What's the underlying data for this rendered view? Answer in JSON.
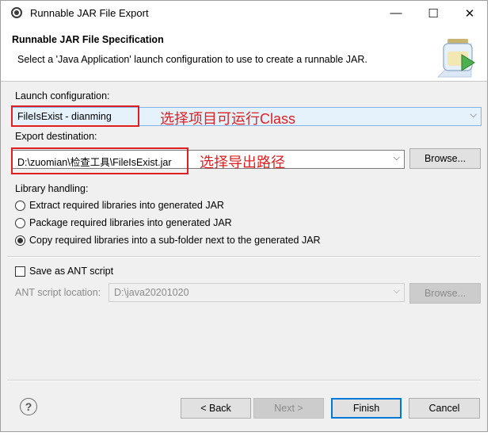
{
  "window": {
    "title": "Runnable JAR File Export",
    "minimize_glyph": "—",
    "maximize_glyph": "☐",
    "close_glyph": "✕"
  },
  "header": {
    "title": "Runnable JAR File Specification",
    "description": "Select a 'Java Application' launch configuration to use to create a runnable JAR."
  },
  "launch": {
    "label": "Launch configuration:",
    "value": "FileIsExist - dianming",
    "annotation": "选择项目可运行Class"
  },
  "export": {
    "label": "Export destination:",
    "value": "D:\\zuomian\\检查工具\\FileIsExist.jar",
    "annotation": "选择导出路径",
    "browse_label": "Browse..."
  },
  "library": {
    "label": "Library handling:",
    "options": [
      {
        "label": "Extract required libraries into generated JAR",
        "selected": false
      },
      {
        "label": "Package required libraries into generated JAR",
        "selected": false
      },
      {
        "label": "Copy required libraries into a sub-folder next to the generated JAR",
        "selected": true
      }
    ]
  },
  "ant": {
    "checkbox_label": "Save as ANT script",
    "checked": false,
    "location_label": "ANT script location:",
    "location_value": "D:\\java20201020",
    "browse_label": "Browse..."
  },
  "footer": {
    "help_glyph": "?",
    "back_label": "< Back",
    "next_label": "Next >",
    "finish_label": "Finish",
    "cancel_label": "Cancel"
  },
  "colors": {
    "annotation": "#e02020",
    "dialog_bg": "#f0f0f0",
    "focus_blue": "#0078d7"
  },
  "icons": [
    "eclipse-icon",
    "jar-wizard-icon",
    "help-icon",
    "chevron-down-icon"
  ]
}
